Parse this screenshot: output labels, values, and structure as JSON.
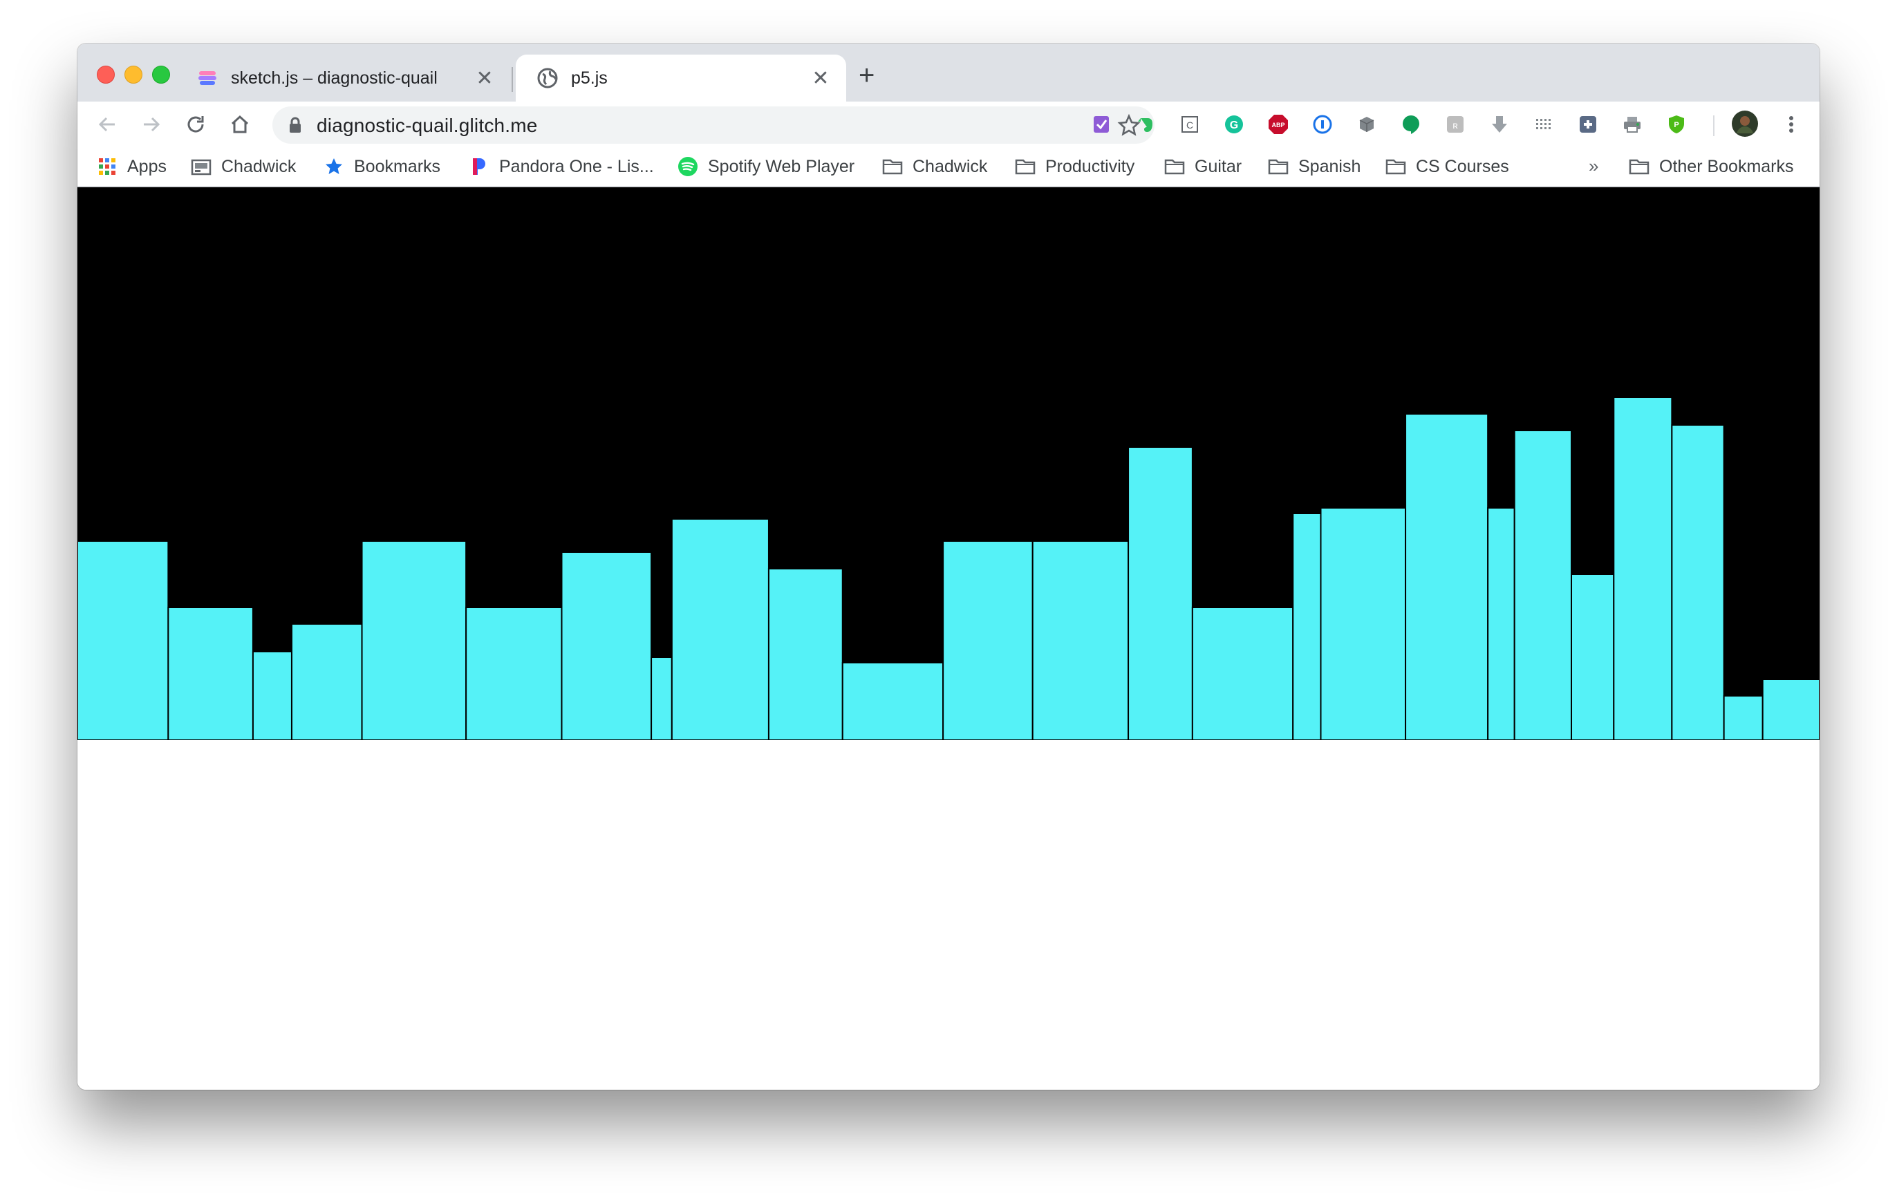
{
  "browser": {
    "tabs": [
      {
        "title": "sketch.js – diagnostic-quail",
        "favicon": "glitch-favicon",
        "close": "✕",
        "active": false
      },
      {
        "title": "p5.js",
        "favicon": "globe-icon",
        "close": "✕",
        "active": true
      }
    ],
    "new_tab": "+",
    "url": "diagnostic-quail.glitch.me",
    "extensions": [
      "onenote-clipper-icon",
      "evernote-icon",
      "clipboard-icon",
      "grammarly-icon",
      "adblock-plus-icon",
      "onepassword-icon",
      "cube-icon",
      "hangouts-icon",
      "feedly-icon",
      "download-icon",
      "grid-icon",
      "puzzle-icon",
      "print-icon",
      "shield-icon"
    ],
    "bookmarks_overflow": "»"
  },
  "bookmarks": [
    {
      "label": "Apps",
      "icon": "apps-grid-icon"
    },
    {
      "label": "Chadwick",
      "icon": "classroom-icon"
    },
    {
      "label": "Bookmarks",
      "icon": "star-icon"
    },
    {
      "label": "Pandora One - Lis...",
      "icon": "pandora-icon"
    },
    {
      "label": "Spotify Web Player",
      "icon": "spotify-icon"
    },
    {
      "label": "Chadwick",
      "icon": "folder-icon"
    },
    {
      "label": "Productivity",
      "icon": "folder-icon"
    },
    {
      "label": "Guitar",
      "icon": "folder-icon"
    },
    {
      "label": "Spanish",
      "icon": "folder-icon"
    },
    {
      "label": "CS Courses",
      "icon": "folder-icon"
    },
    {
      "label": "Other Bookmarks",
      "icon": "folder-icon"
    }
  ],
  "colors": {
    "canvas_bg": "#000000",
    "bar_fill": "#55f2f7",
    "bar_stroke": "#000000"
  },
  "chart_data": {
    "type": "bar",
    "bar_heights_fraction_of_canvas": [
      0.36,
      0.24,
      0.16,
      0.21,
      0.36,
      0.24,
      0.34,
      0.15,
      0.4,
      0.31,
      0.14,
      0.36,
      0.36,
      0.53,
      0.24,
      0.41,
      0.42,
      0.59,
      0.42,
      0.56,
      0.3,
      0.62,
      0.57,
      0.08,
      0.11
    ],
    "bar_widths_relative": [
      75,
      70,
      32,
      58,
      86,
      79,
      74,
      17,
      80,
      61,
      83,
      74,
      79,
      53,
      83,
      23,
      70,
      68,
      22,
      47,
      35,
      48,
      43,
      32,
      47
    ]
  }
}
